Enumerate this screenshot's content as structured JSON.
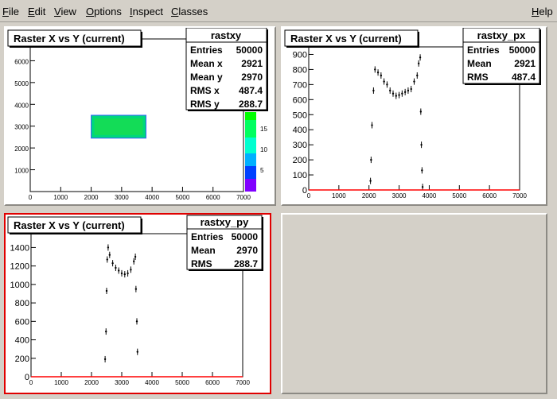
{
  "menu": {
    "file": {
      "u": "F",
      "rest": "ile"
    },
    "edit": {
      "u": "E",
      "rest": "dit"
    },
    "view": {
      "u": "V",
      "rest": "iew"
    },
    "options": {
      "u": "O",
      "rest": "ptions"
    },
    "inspect": {
      "u": "I",
      "rest": "nspect"
    },
    "classes": {
      "u": "C",
      "rest": "lasses"
    },
    "help": {
      "u": "H",
      "rest": "elp"
    }
  },
  "colors": {
    "active_pad_border": "#e00000",
    "line": "#ff0000"
  },
  "pads": {
    "xy": {
      "title": "Raster X vs Y (current)",
      "stats": {
        "name": "rastxy",
        "rows": [
          [
            "Entries",
            "50000"
          ],
          [
            "Mean x",
            "2921"
          ],
          [
            "Mean y",
            "2970"
          ],
          [
            "RMS x",
            "487.4"
          ],
          [
            "RMS y",
            "288.7"
          ]
        ]
      },
      "chart_data": {
        "type": "heatmap",
        "xlim": [
          0,
          7000
        ],
        "ylim": [
          0,
          7000
        ],
        "xticks": [
          "0",
          "1000",
          "2000",
          "3000",
          "4000",
          "5000",
          "6000",
          "7000"
        ],
        "yticks": [
          "1000",
          "2000",
          "3000",
          "4000",
          "5000",
          "6000"
        ],
        "region": {
          "x": [
            2000,
            3800
          ],
          "y": [
            2450,
            3500
          ]
        },
        "palette_ticks": [
          "5",
          "10",
          "15"
        ]
      }
    },
    "px": {
      "title": "Raster X vs Y (current)",
      "stats": {
        "name": "rastxy_px",
        "rows": [
          [
            "Entries",
            "50000"
          ],
          [
            "Mean",
            "2921"
          ],
          [
            "RMS",
            "487.4"
          ]
        ]
      },
      "chart_data": {
        "type": "line",
        "xlim": [
          0,
          7000
        ],
        "ylim": [
          0,
          950
        ],
        "xticks": [
          "0",
          "1000",
          "2000",
          "3000",
          "4000",
          "5000",
          "6000",
          "7000"
        ],
        "yticks": [
          "0",
          "100",
          "200",
          "300",
          "400",
          "500",
          "600",
          "700",
          "800",
          "900"
        ],
        "x": [
          2050,
          2070,
          2100,
          2150,
          2200,
          2300,
          2400,
          2500,
          2600,
          2700,
          2800,
          2900,
          3000,
          3100,
          3200,
          3300,
          3400,
          3500,
          3600,
          3650,
          3700,
          3720,
          3740,
          3760,
          3780
        ],
        "y": [
          60,
          200,
          430,
          660,
          800,
          780,
          760,
          720,
          700,
          660,
          640,
          625,
          630,
          640,
          650,
          660,
          670,
          720,
          760,
          840,
          880,
          520,
          300,
          130,
          20
        ]
      }
    },
    "py": {
      "title": "Raster X vs Y (current)",
      "stats": {
        "name": "rastxy_py",
        "rows": [
          [
            "Entries",
            "50000"
          ],
          [
            "Mean",
            "2970"
          ],
          [
            "RMS",
            "288.7"
          ]
        ]
      },
      "chart_data": {
        "type": "line",
        "xlim": [
          0,
          7000
        ],
        "ylim": [
          0,
          1550
        ],
        "xticks": [
          "0",
          "1000",
          "2000",
          "3000",
          "4000",
          "5000",
          "6000",
          "7000"
        ],
        "yticks": [
          "0",
          "200",
          "400",
          "600",
          "800",
          "1000",
          "1200",
          "1400"
        ],
        "x": [
          2450,
          2480,
          2500,
          2520,
          2550,
          2600,
          2700,
          2800,
          2900,
          3000,
          3100,
          3200,
          3300,
          3400,
          3450,
          3470,
          3500,
          3520
        ],
        "y": [
          190,
          490,
          930,
          1270,
          1400,
          1320,
          1230,
          1180,
          1150,
          1120,
          1110,
          1120,
          1160,
          1250,
          1300,
          950,
          600,
          270
        ]
      }
    }
  }
}
